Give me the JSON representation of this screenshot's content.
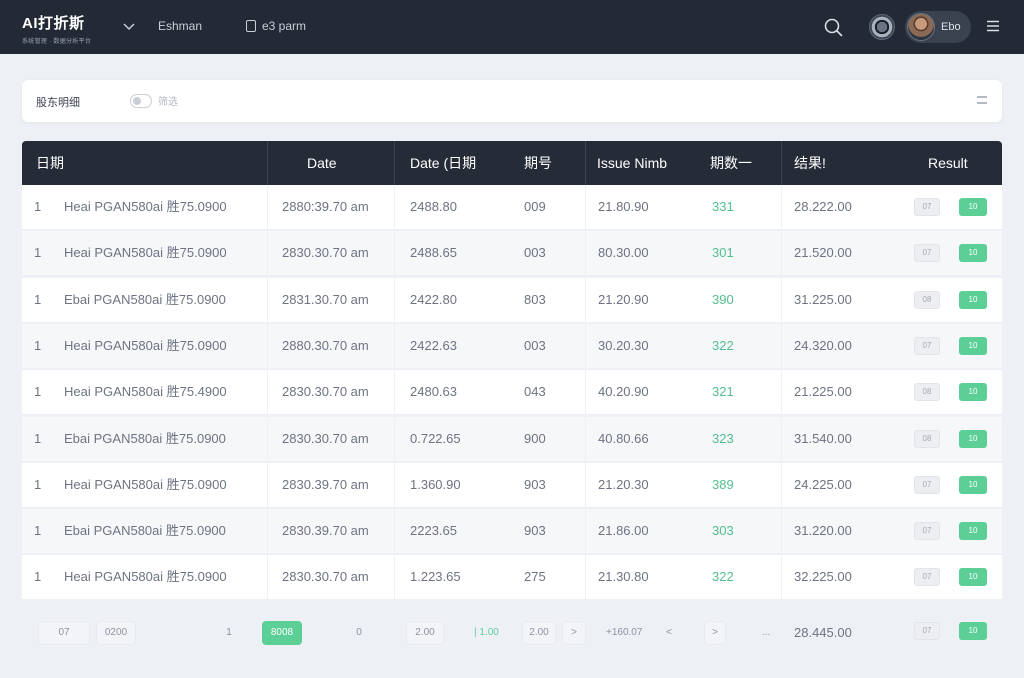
{
  "app": {
    "brand_title": "AI打折斯",
    "brand_subtitle": "系统管理 · 数据分析平台",
    "nav_item_1": "Eshman",
    "nav_item_2": "e3 parm",
    "user_name": "Ebo"
  },
  "colors": {
    "topbar": "#232a36",
    "accent_green": "#5ccf97",
    "table_header": "#252c38"
  },
  "icons": {
    "search": "search-icon",
    "menu": "hamburger-menu-icon",
    "chevron": "chevron-down-icon",
    "doc": "document-icon"
  },
  "filter": {
    "label": "股东明细",
    "toggle_text": "筛选"
  },
  "table": {
    "columns": [
      "日期",
      "Date",
      "Date (日期",
      "期号",
      "Issue Nimb",
      "期数一",
      "结果!",
      "Result"
    ],
    "rows": [
      {
        "idx": "1",
        "name": "Heai PGAN580ai 胜75.0900",
        "date": "2880:39.70 am",
        "val1": "2488.80",
        "num": "009",
        "issue": "21.80.90",
        "green": "331",
        "result": "28.222.00",
        "b1": "07",
        "b2": "10"
      },
      {
        "idx": "1",
        "name": "Heai PGAN580ai 胜75.0900",
        "date": "2830.30.70 am",
        "val1": "2488.65",
        "num": "003",
        "issue": "80.30.00",
        "green": "301",
        "result": "21.520.00",
        "b1": "07",
        "b2": "10"
      },
      {
        "idx": "1",
        "name": "Ebai PGAN580ai 胜75.0900",
        "date": "2831.30.70 am",
        "val1": "2422.80",
        "num": "803",
        "issue": "21.20.90",
        "green": "390",
        "result": "31.225.00",
        "b1": "08",
        "b2": "10"
      },
      {
        "idx": "1",
        "name": "Heai PGAN580ai 胜75.0900",
        "date": "2880.30.70 am",
        "val1": "2422.63",
        "num": "003",
        "issue": "30.20.30",
        "green": "322",
        "result": "24.320.00",
        "b1": "07",
        "b2": "10"
      },
      {
        "idx": "1",
        "name": "Heai PGAN580ai 胜75.4900",
        "date": "2830.30.70 am",
        "val1": "2480.63",
        "num": "043",
        "issue": "40.20.90",
        "green": "321",
        "result": "21.225.00",
        "b1": "08",
        "b2": "10"
      },
      {
        "idx": "1",
        "name": "Ebai PGAN580ai 胜75.0900",
        "date": "2830.30.70 am",
        "val1": "0.722.65",
        "num": "900",
        "issue": "40.80.66",
        "green": "323",
        "result": "31.540.00",
        "b1": "08",
        "b2": "10"
      },
      {
        "idx": "1",
        "name": "Heai PGAN580ai 胜75.0900",
        "date": "2830.39.70 am",
        "val1": "1.360.90",
        "num": "903",
        "issue": "21.20.30",
        "green": "389",
        "result": "24.225.00",
        "b1": "07",
        "b2": "10"
      },
      {
        "idx": "1",
        "name": "Ebai PGAN580ai 胜75.0900",
        "date": "2830.39.70 am",
        "val1": "2223.65",
        "num": "903",
        "issue": "21.86.00",
        "green": "303",
        "result": "31.220.00",
        "b1": "07",
        "b2": "10"
      },
      {
        "idx": "1",
        "name": "Heai PGAN580ai 胜75.0900",
        "date": "2830.30.70 am",
        "val1": "1.223.65",
        "num": "275",
        "issue": "21.30.80",
        "green": "322",
        "result": "32.225.00",
        "b1": "07",
        "b2": "10"
      }
    ]
  },
  "footer": {
    "p1": "07",
    "p2": "0200",
    "p3": "1",
    "p4": "8008",
    "p5": "0",
    "p6": "2.00",
    "bar_text": "| 1.00",
    "p7": "2.00",
    "p8": ">",
    "range": "+160.07",
    "p9": "<",
    "p10": ">",
    "p11": "...",
    "result": "28.445.00",
    "b1": "07",
    "b2": "10"
  }
}
